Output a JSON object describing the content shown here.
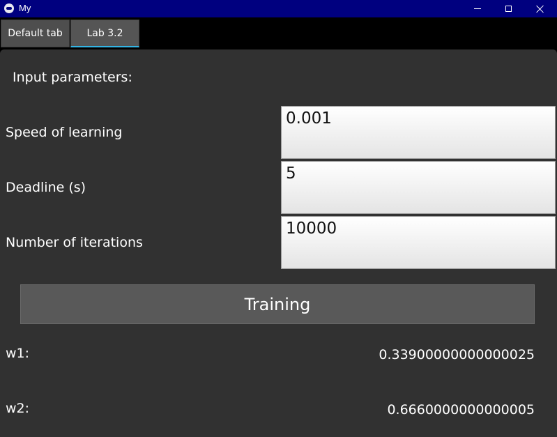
{
  "window": {
    "title": "My",
    "icon": "kivy-app-icon"
  },
  "tabs": [
    {
      "label": "Default tab",
      "selected": false
    },
    {
      "label": "Lab 3.2",
      "selected": true
    }
  ],
  "form": {
    "heading": "Input parameters:",
    "speed": {
      "label": "Speed of learning",
      "value": "0.001"
    },
    "deadline": {
      "label": "Deadline (s)",
      "value": "5"
    },
    "iterations": {
      "label": "Number of iterations",
      "value": "10000"
    }
  },
  "actions": {
    "train_label": "Training"
  },
  "results": {
    "w1": {
      "label": "w1:",
      "value": "0.33900000000000025"
    },
    "w2": {
      "label": "w2:",
      "value": "0.6660000000000005"
    }
  },
  "colors": {
    "titlebar": "#00007f",
    "panel": "#313131",
    "tab_accent": "#33b5e5",
    "button": "#595959"
  }
}
